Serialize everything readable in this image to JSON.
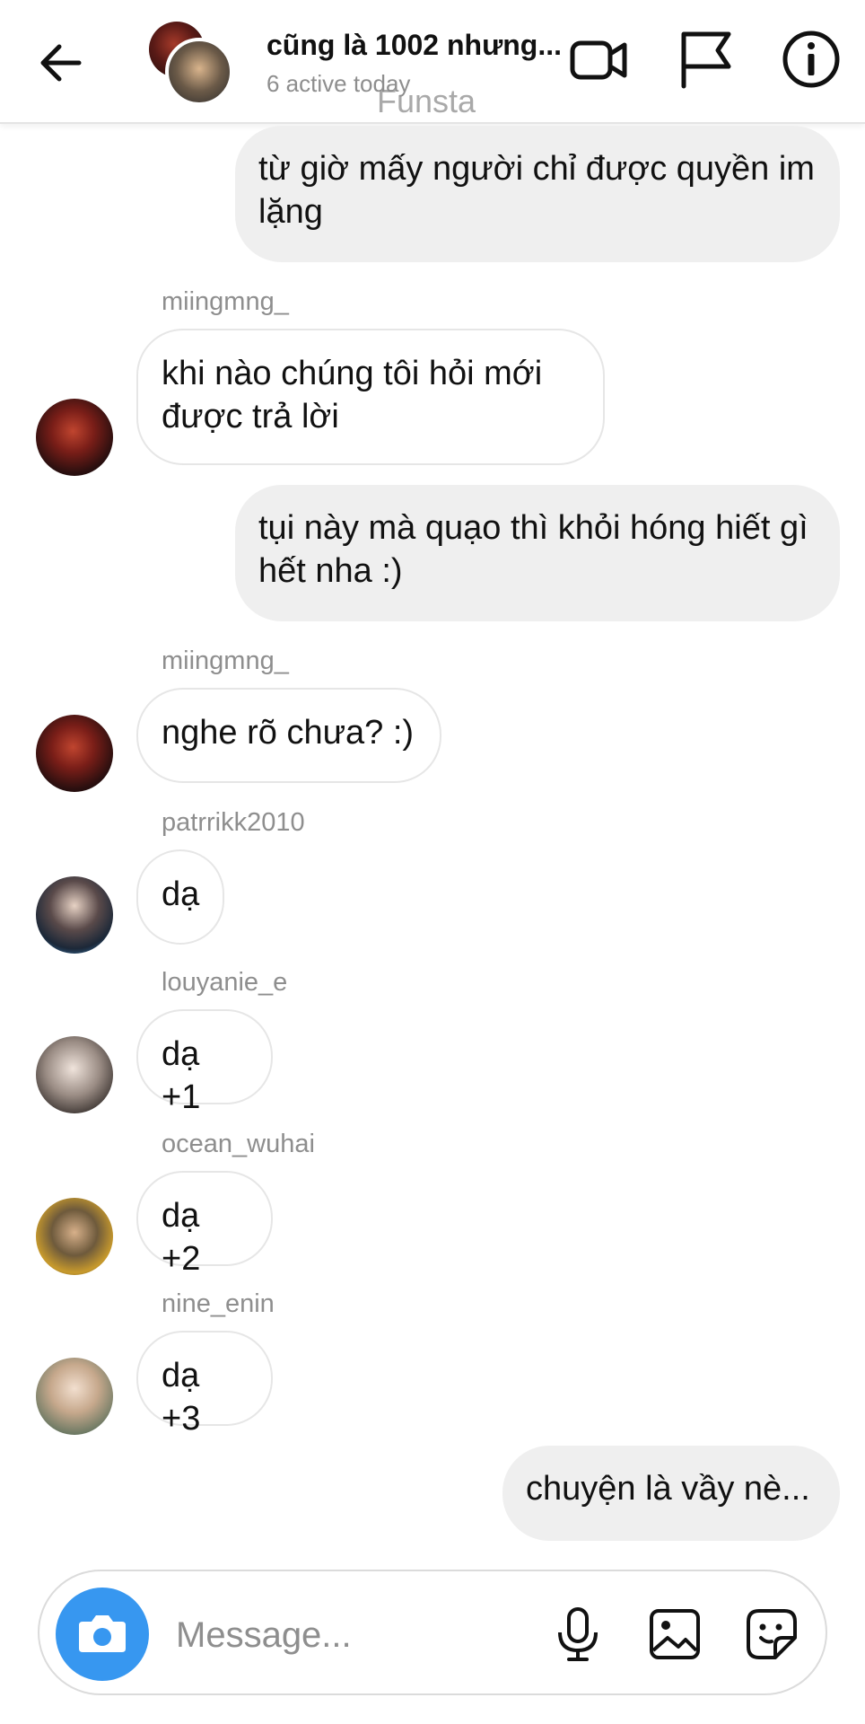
{
  "header": {
    "title": "cũng là 1002 nhưng...",
    "subtitle": "6 active today",
    "watermark": "Funsta",
    "icons": [
      "back-arrow-icon",
      "video-call-icon",
      "flag-icon",
      "info-icon"
    ]
  },
  "messages": [
    {
      "kind": "outgoing",
      "text": "từ giờ mấy người chỉ được quyền im lặng"
    },
    {
      "kind": "incoming",
      "sender": "miingmng_",
      "text": "khi nào chúng tôi hỏi mới được trả lời"
    },
    {
      "kind": "outgoing",
      "text": "tụi này mà quạo thì khỏi hóng hiết gì hết nha :)"
    },
    {
      "kind": "incoming",
      "sender": "miingmng_",
      "text": "nghe rõ chưa? :)"
    },
    {
      "kind": "incoming",
      "sender": "patrrikk2010",
      "text": "dạ"
    },
    {
      "kind": "incoming",
      "sender": "louyanie_e",
      "text": "dạ +1"
    },
    {
      "kind": "incoming",
      "sender": "ocean_wuhai",
      "text": "dạ +2"
    },
    {
      "kind": "incoming",
      "sender": "nine_enin",
      "text": "dạ +3"
    },
    {
      "kind": "outgoing",
      "text": "chuyện là vầy nè..."
    }
  ],
  "composer": {
    "placeholder": "Message...",
    "icons": [
      "camera-icon",
      "microphone-icon",
      "gallery-icon",
      "sticker-icon"
    ]
  },
  "colors": {
    "accent": "#3797f0",
    "outgoing_bubble": "#efefef",
    "incoming_border": "#e6e6e6",
    "secondary_text": "#8e8e8e"
  }
}
